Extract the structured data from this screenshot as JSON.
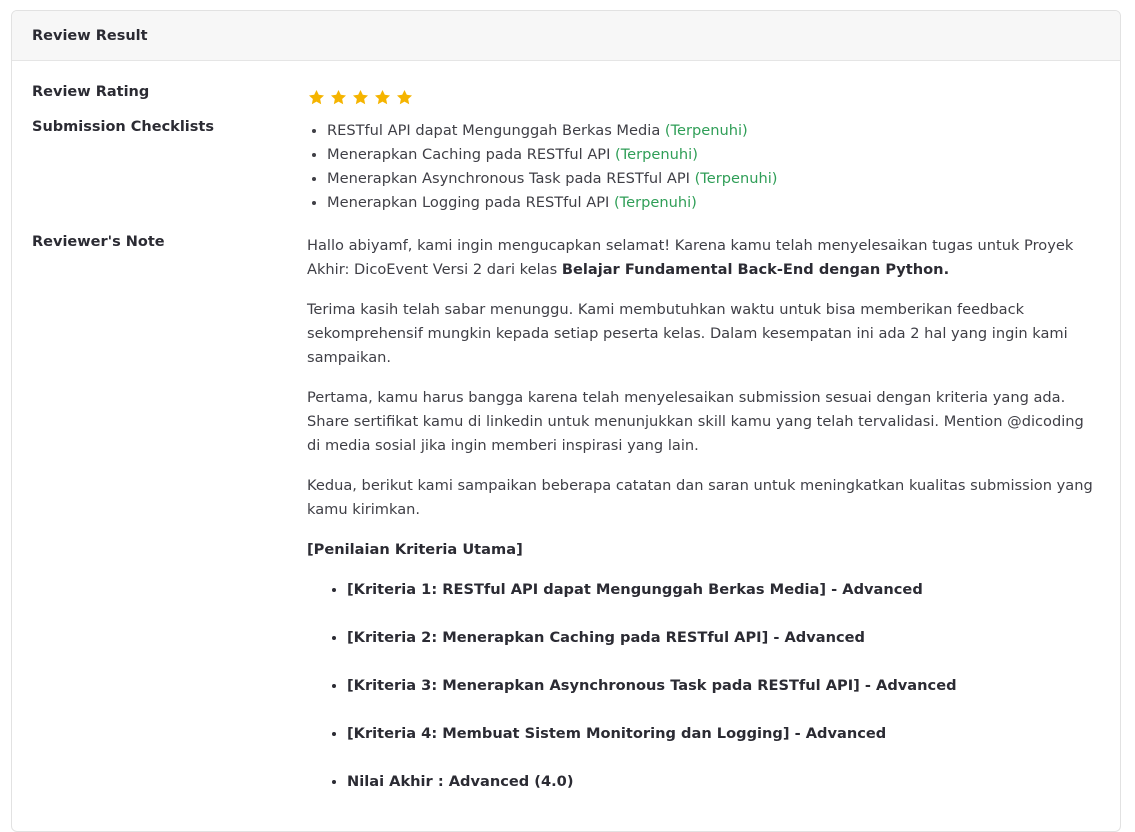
{
  "card": {
    "title": "Review Result"
  },
  "rating": {
    "label": "Review Rating",
    "value": 5,
    "max": 5,
    "star_color": "#f5b400"
  },
  "checklist": {
    "label": "Submission Checklists",
    "items": [
      {
        "text": "RESTful API dapat Mengunggah Berkas Media",
        "status": "(Terpenuhi)"
      },
      {
        "text": "Menerapkan Caching pada RESTful API",
        "status": "(Terpenuhi)"
      },
      {
        "text": "Menerapkan Asynchronous Task pada RESTful API",
        "status": "(Terpenuhi)"
      },
      {
        "text": "Menerapkan Logging pada RESTful API",
        "status": "(Terpenuhi)"
      }
    ],
    "status_color": "#2f9e57"
  },
  "note": {
    "label": "Reviewer's Note",
    "p1_text": "Hallo abiyamf, kami ingin mengucapkan selamat! Karena kamu telah menyelesaikan tugas untuk Proyek Akhir: DicoEvent Versi 2 dari kelas ",
    "p1_bold": "Belajar Fundamental Back-End dengan Python.",
    "p2": "Terima kasih telah sabar menunggu. Kami membutuhkan waktu untuk bisa memberikan feedback sekomprehensif mungkin kepada setiap peserta kelas. Dalam kesempatan ini ada 2 hal yang ingin kami sampaikan.",
    "p3": "Pertama, kamu harus bangga karena telah menyelesaikan submission sesuai dengan kriteria yang ada. Share sertifikat kamu di linkedin untuk menunjukkan skill kamu yang telah tervalidasi. Mention @dicoding di media sosial jika ingin memberi inspirasi yang lain.",
    "p4": "Kedua, berikut kami sampaikan beberapa catatan dan saran untuk meningkatkan kualitas submission yang kamu kirimkan.",
    "criteria_title": "[Penilaian Kriteria Utama]",
    "criteria": [
      "[Kriteria 1: RESTful API dapat Mengunggah Berkas Media] - Advanced",
      "[Kriteria 2: Menerapkan Caching pada RESTful API] - Advanced",
      "[Kriteria 3: Menerapkan Asynchronous Task pada RESTful API] - Advanced",
      "[Kriteria 4: Membuat Sistem Monitoring dan Logging] - Advanced",
      "Nilai Akhir : Advanced (4.0)"
    ]
  }
}
